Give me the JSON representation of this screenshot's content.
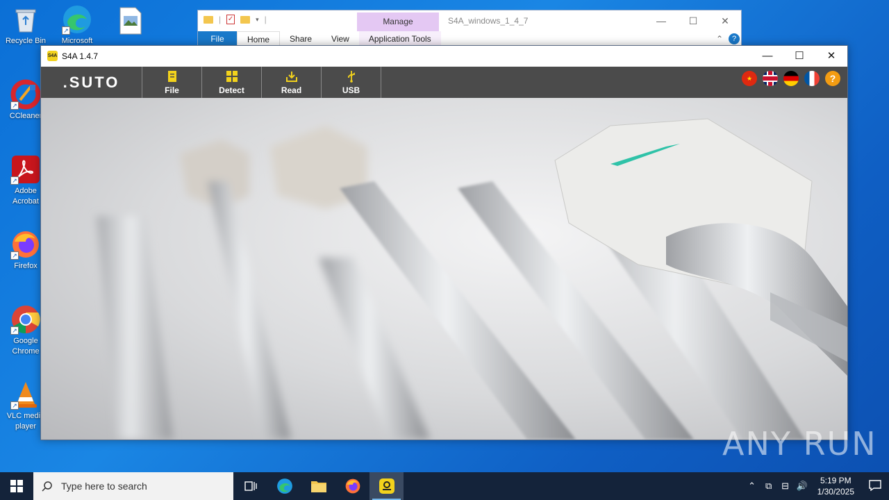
{
  "desktop": {
    "icons": [
      {
        "label": "Recycle Bin"
      },
      {
        "label": "Microsoft"
      },
      {
        "label": "CCleaner"
      },
      {
        "label": "Adobe Acrobat"
      },
      {
        "label": "Firefox"
      },
      {
        "label": "Google Chrome"
      },
      {
        "label": "VLC media player"
      }
    ]
  },
  "explorer": {
    "title": "S4A_windows_1_4_7",
    "manage_label": "Manage",
    "tabs": [
      "File",
      "Home",
      "Share",
      "View",
      "Application Tools"
    ]
  },
  "s4a": {
    "title": "S4A  1.4.7",
    "brand": ".SUTO",
    "toolbar": {
      "file": "File",
      "detect": "Detect",
      "read": "Read",
      "usb": "USB"
    },
    "languages": [
      "zh-flag-icon",
      "gb-flag-icon",
      "de-flag-icon",
      "fr-flag-icon"
    ],
    "help": "?"
  },
  "taskbar": {
    "search_placeholder": "Type here to search",
    "time": "5:19 PM",
    "date": "1/30/2025"
  },
  "watermark": "ANY RUN",
  "colors": {
    "toolbar_bg": "#4b4b4b",
    "brand_accent": "#2fc2a8",
    "toolbar_icon": "#f2d21c",
    "taskbar_bg": "#14233a"
  }
}
